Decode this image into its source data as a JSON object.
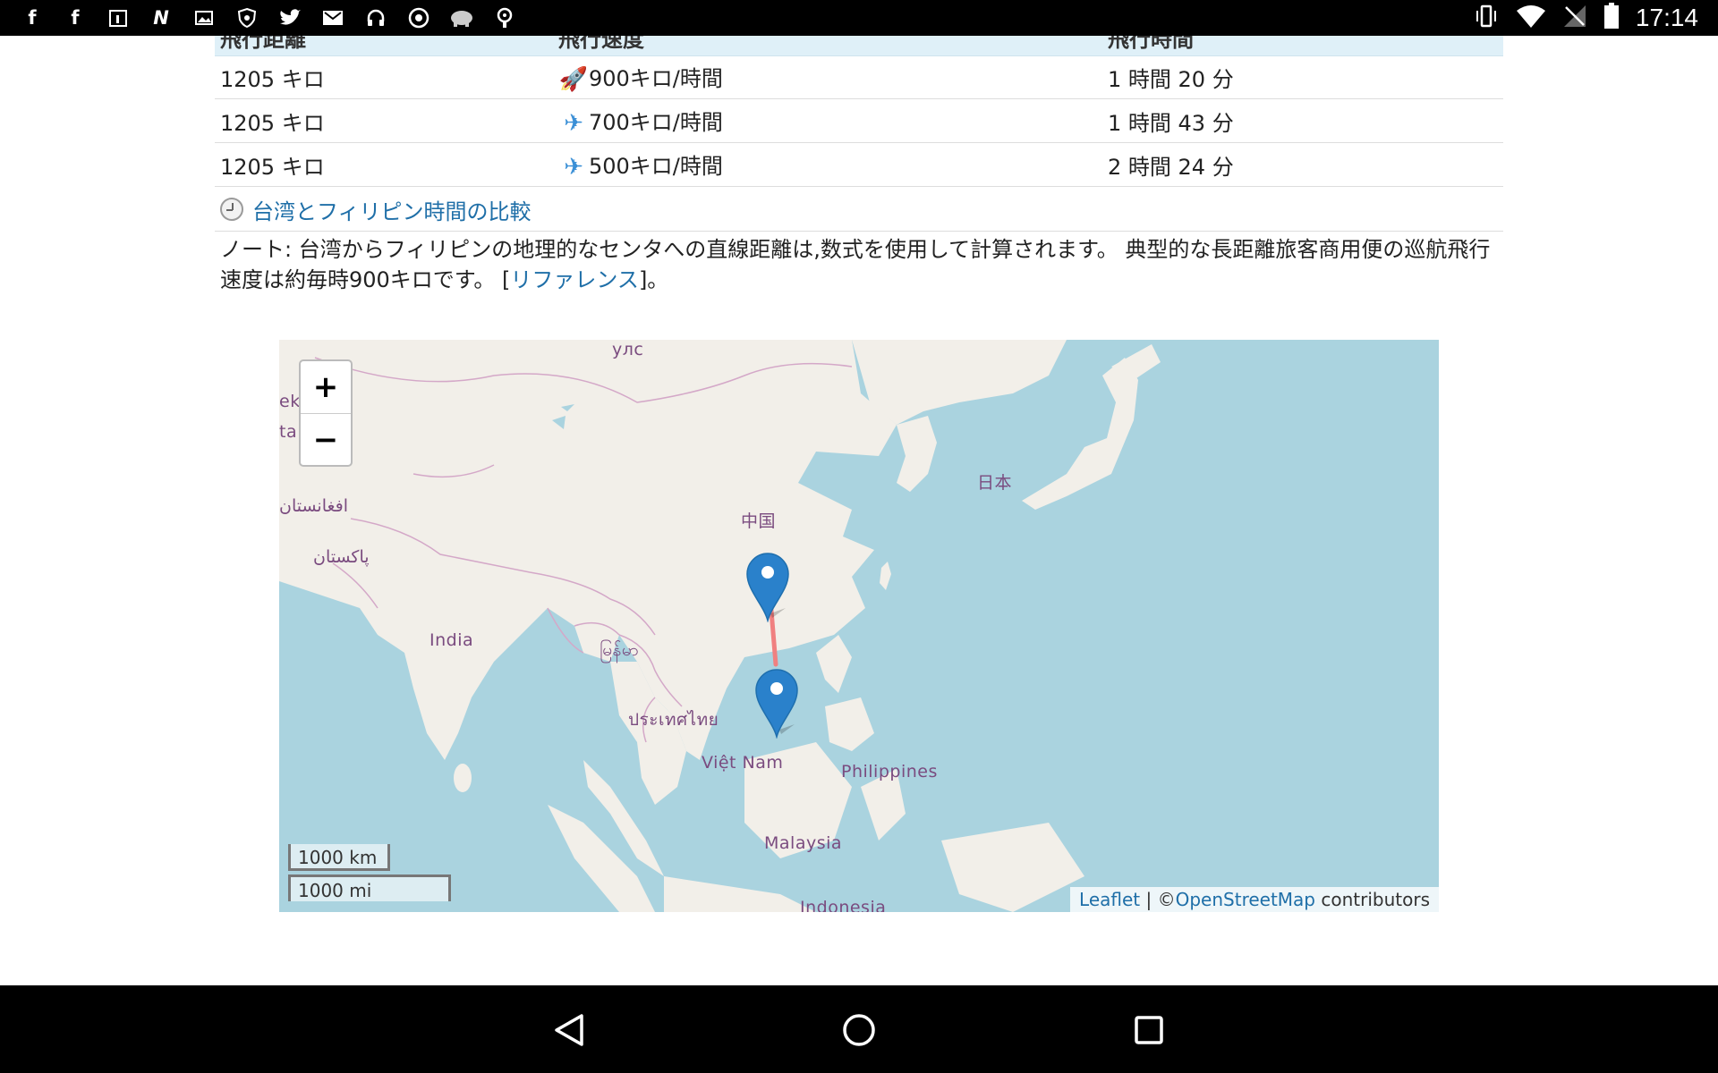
{
  "status_bar": {
    "time": "17:14",
    "left_icons": [
      "facebook-icon",
      "facebook-icon",
      "calendar-icon",
      "n-app-icon",
      "image-icon",
      "shield-icon",
      "twitter-icon",
      "gmail-icon",
      "headset-icon",
      "chrome-icon",
      "elephant-icon",
      "key-icon"
    ],
    "right_icons": [
      "vibrate-icon",
      "wifi-icon",
      "no-signal-icon",
      "battery-icon"
    ]
  },
  "table": {
    "headers": [
      "飛行距離",
      "飛行速度",
      "飛行時間"
    ],
    "rows": [
      {
        "distance": "1205 キロ",
        "speed": "900キロ/時間",
        "time": "1 時間 20 分",
        "icon": "rocket-icon",
        "icon_glyph": "🚀"
      },
      {
        "distance": "1205 キロ",
        "speed": "700キロ/時間",
        "time": "1 時間 43 分",
        "icon": "airplane-icon",
        "icon_glyph": "✈"
      },
      {
        "distance": "1205 キロ",
        "speed": "500キロ/時間",
        "time": "2 時間 24 分",
        "icon": "airplane-icon",
        "icon_glyph": "✈"
      }
    ]
  },
  "compare_link": "台湾とフィリピン時間の比較",
  "note": {
    "text": "ノート: 台湾からフィリピンの地理的なセンタへの直線距離は,数式を使用して計算されます。 典型的な長距離旅客商用便の巡航飛行速度は約毎時900キロです。 [",
    "link": "リファレンス",
    "suffix": "]。"
  },
  "map": {
    "zoom_in": "+",
    "zoom_out": "−",
    "scale_km": "1000 km",
    "scale_mi": "1000 mi",
    "attribution": {
      "leaflet": "Leaflet",
      "sep": " | ©",
      "osm": "OpenStreetMap",
      "contributors": " contributors"
    },
    "labels": {
      "mongolia": "улс",
      "china": "中国",
      "japan": "日本",
      "afghanistan": "افغانستان",
      "pakistan": "پاکستان",
      "india": "India",
      "myanmar": "မြန်မာ",
      "thailand": "ประเทศไทย",
      "vietnam": "Việt Nam",
      "philippines": "Philippines",
      "malaysia": "Malaysia",
      "indonesia": "Indonesia",
      "edge1": "ek",
      "edge2": "ta"
    },
    "colors": {
      "water": "#aad3df",
      "land": "#f2efe9",
      "route": "#f08080",
      "marker": "#2a81cb"
    }
  }
}
